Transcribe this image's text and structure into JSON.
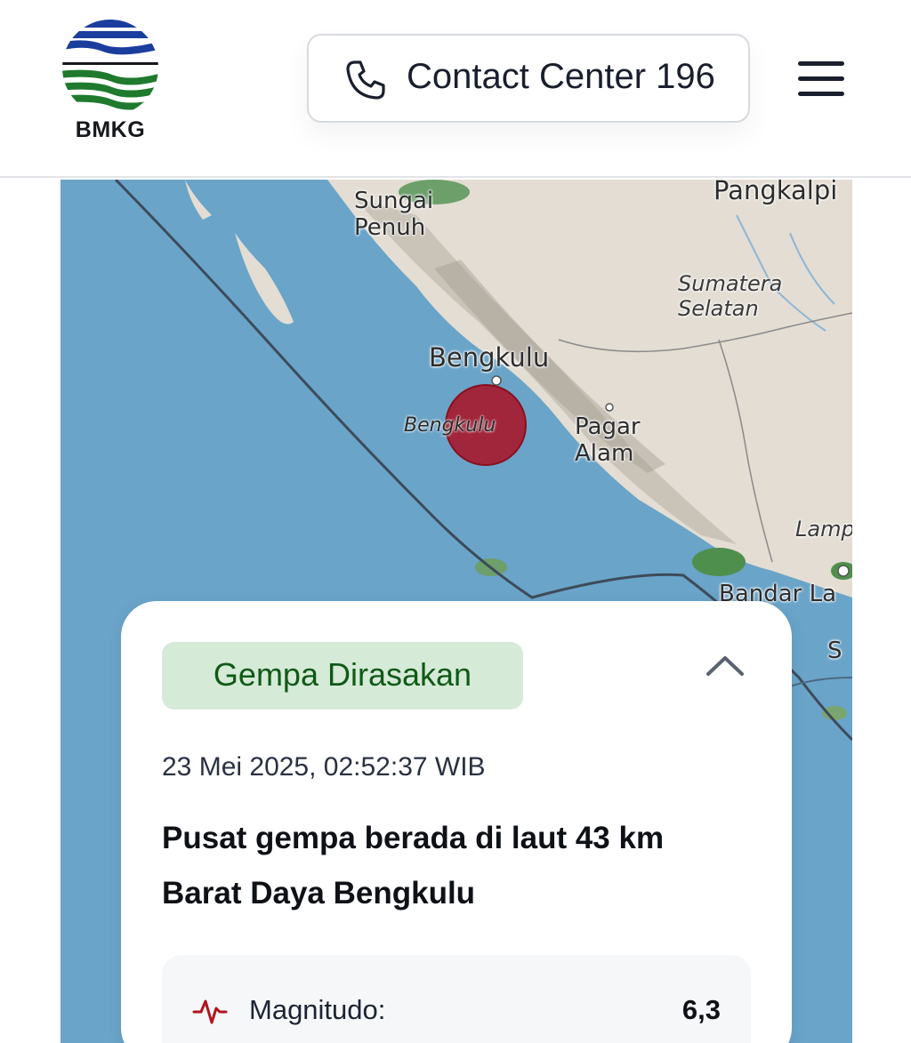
{
  "header": {
    "logo": {
      "text": "BMKG",
      "icon": "bmkg-logo"
    },
    "contact": {
      "icon": "phone-icon",
      "label": "Contact Center 196"
    },
    "menu": {
      "icon": "hamburger-menu-icon"
    }
  },
  "map": {
    "labels": {
      "sungai_penuh_1": "Sungai",
      "sungai_penuh_2": "Penuh",
      "pangkalpinang": "Pangkalpi",
      "sumatera_selatan_1": "Sumatera",
      "sumatera_selatan_2": "Selatan",
      "bengkulu_city": "Bengkulu",
      "bengkulu_prov": "Bengkulu",
      "pagar_alam_1": "Pagar",
      "pagar_alam_2": "Alam",
      "lampung": "Lamp",
      "bandar_lampung": "Bandar La",
      "edge_label": "S"
    },
    "colors": {
      "sea": "#6aa4c9",
      "land": "#e3ddd3",
      "epicenter": "#aa1022"
    }
  },
  "card": {
    "badge": "Gempa Dirasakan",
    "collapse_icon": "chevron-up-icon",
    "datetime": "23 Mei 2025, 02:52:37 WIB",
    "headline": "Pusat gempa berada di laut 43 km Barat Daya Bengkulu",
    "magnitude": {
      "icon": "seismograph-icon",
      "label": "Magnitudo:",
      "value": "6,3"
    }
  }
}
